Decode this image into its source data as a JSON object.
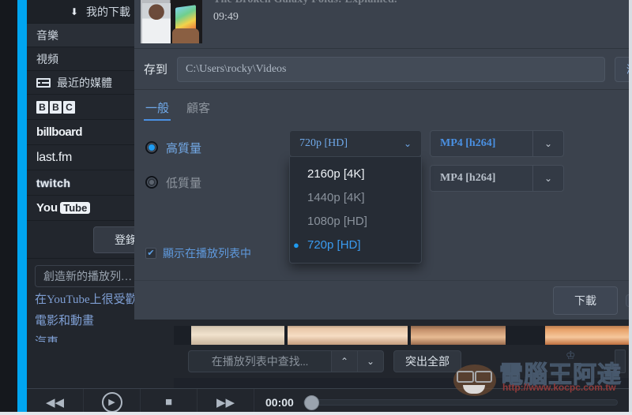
{
  "sidebar": {
    "header": {
      "label": "我的下載",
      "icon": "download-arrow-icon"
    },
    "items": [
      {
        "label": "音樂",
        "type": "text",
        "highlight": true
      },
      {
        "label": "視頻",
        "type": "text",
        "highlight": false
      },
      {
        "label": "最近的媒體",
        "type": "text",
        "icon": "stack-icon",
        "highlight": false
      }
    ],
    "services": [
      {
        "name": "bbc-logo",
        "label": "BBC",
        "letters": [
          "B",
          "B",
          "C"
        ]
      },
      {
        "name": "billboard-logo",
        "label": "billboard"
      },
      {
        "name": "lastfm-logo",
        "label": "last.fm"
      },
      {
        "name": "twitch-logo",
        "label": "twitch"
      },
      {
        "name": "youtube-logo",
        "label_you": "You",
        "label_tube": "Tube"
      }
    ],
    "login_button": "登錄",
    "new_playlist_placeholder": "創造新的播放列…",
    "categories": [
      "在YouTube上很受歡迎",
      "電影和動畫",
      "汽車"
    ]
  },
  "dialog": {
    "video_title": "The Broken Galaxy Folds: Explained.",
    "duration": "09:49",
    "save_to_label": "存到",
    "save_to_path": "C:\\Users\\rocky\\Videos",
    "browse_button": "瀏",
    "tabs": [
      {
        "label": "一般",
        "active": true
      },
      {
        "label": "顧客",
        "active": false
      }
    ],
    "options": [
      {
        "label": "高質量",
        "selected": true
      },
      {
        "label": "低質量",
        "selected": false
      }
    ],
    "quality_select": {
      "value": "720p [HD]",
      "open": true,
      "chevron": "chevron-down-icon",
      "options": [
        {
          "label": "2160p [4K]",
          "state": "hover"
        },
        {
          "label": "1440p [4K]",
          "state": "normal"
        },
        {
          "label": "1080p [HD]",
          "state": "normal"
        },
        {
          "label": "720p [HD]",
          "state": "selected"
        }
      ]
    },
    "format_selects": [
      {
        "value": "MP4 [h264]",
        "emphasis": "high"
      },
      {
        "value": "MP4 [h264]",
        "emphasis": "low"
      }
    ],
    "show_in_playlist": {
      "label": "顯示在播放列表中",
      "checked": true,
      "check_glyph": "✔"
    },
    "download_button": "下載"
  },
  "bottom": {
    "search_placeholder": "在播放列表中查找...",
    "spin_up": "chevron-up-icon",
    "spin_down": "chevron-down-icon",
    "highlight_all_button": "突出全部"
  },
  "player": {
    "rewind": "rewind-icon",
    "play": "play-icon",
    "stop": "stop-icon",
    "forward": "fast-forward-icon",
    "time": "00:00"
  },
  "watermark": {
    "text": "電腦王阿達",
    "url": "http://www.kocpc.com.tw",
    "crown": "♔"
  },
  "colors": {
    "accent": "#00a5f0",
    "link_blue": "#6fa8e8",
    "dialog_bg": "#3b424d",
    "sidebar_bg": "#22262d"
  }
}
